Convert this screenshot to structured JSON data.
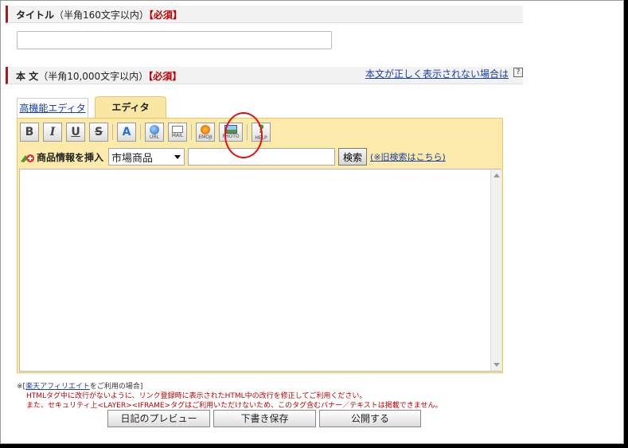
{
  "title_section": {
    "label": "タイトル",
    "note": "（半角160文字以内）",
    "required": "【必須】",
    "input_value": ""
  },
  "body_section": {
    "label": "本 文",
    "note": "（半角10,000文字以内）",
    "required": "【必須】",
    "help_link": "本文が正しく表示されない場合は",
    "help_icon": "?"
  },
  "tabs": [
    {
      "label": "高機能エディタ",
      "active": false
    },
    {
      "label": "エディタ",
      "active": true
    }
  ],
  "toolbar": {
    "bold": "B",
    "italic": "I",
    "underline": "U",
    "strike": "S",
    "font": "A",
    "url": "URL",
    "mail": "MAIL",
    "emoji": "EMOJI",
    "photo": "PHOTO",
    "help": "HELP"
  },
  "insert": {
    "label": "商品情報を挿入",
    "select_value": "市場商品",
    "keyword_value": "",
    "search_button": "検索",
    "old_search_link": "(※旧検索はこちら)"
  },
  "body_text": "",
  "notes": {
    "prefix": "※[",
    "affiliate_link": "楽天アフィリエイト",
    "suffix": "をご利用の場合]",
    "line2": "HTMLタグ中に改行がないように、リンク登録時に表示されたHTML中の改行を修正してご利用ください。",
    "line3": "また、セキュリティ上<LAYER><IFRAME>タグはご利用いただけないため、このタグ含むバナー／テキストは掲載できません。"
  },
  "buttons": {
    "preview": "日記のプレビュー",
    "draft": "下書き保存",
    "publish": "公開する"
  },
  "colors": {
    "accent_red": "#c00000",
    "editor_bg": "#fbeaa9",
    "link_blue": "#1a3ea8",
    "highlight": "#e01010"
  }
}
